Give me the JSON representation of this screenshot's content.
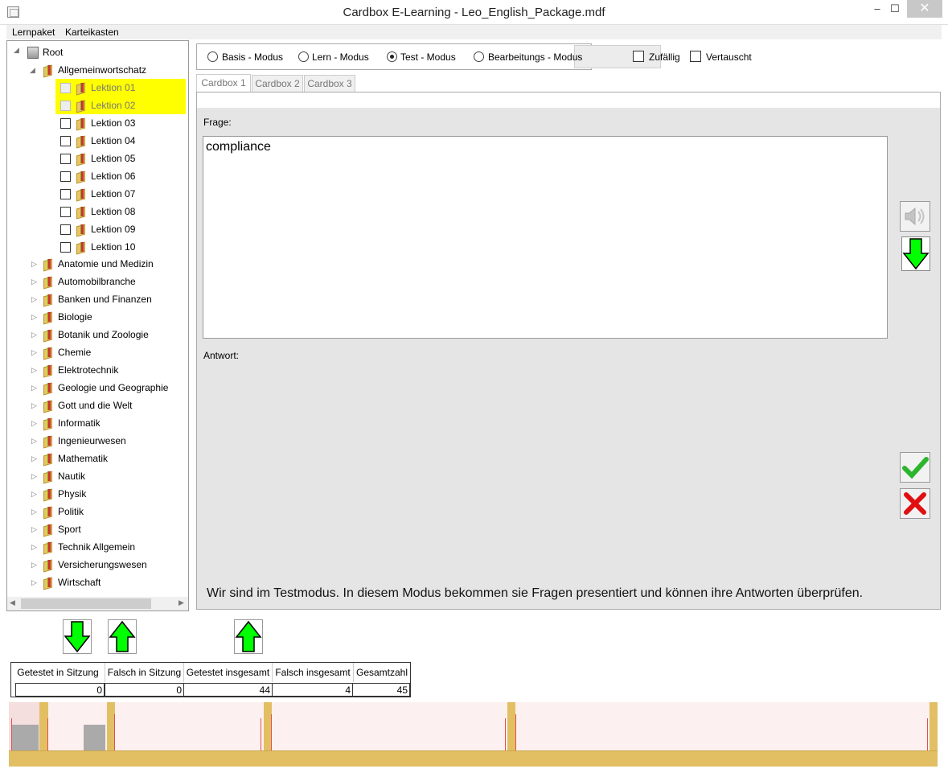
{
  "window": {
    "title": "Cardbox E-Learning - Leo_English_Package.mdf",
    "min": "–",
    "max": "☐",
    "close": "✕"
  },
  "menu": [
    "Lernpaket",
    "Karteikasten"
  ],
  "tree": {
    "root": "Root",
    "expanded": "Allgemeinwortschatz",
    "lessons": [
      "Lektion 01",
      "Lektion 02",
      "Lektion 03",
      "Lektion 04",
      "Lektion 05",
      "Lektion 06",
      "Lektion 07",
      "Lektion 08",
      "Lektion 09",
      "Lektion 10"
    ],
    "highlighted_lessons": [
      "Lektion 01",
      "Lektion 02"
    ],
    "categories": [
      "Anatomie und Medizin",
      "Automobilbranche",
      "Banken und Finanzen",
      "Biologie",
      "Botanik und Zoologie",
      "Chemie",
      "Elektrotechnik",
      "Geologie und Geographie",
      "Gott und die Welt",
      "Informatik",
      "Ingenieurwesen",
      "Mathematik",
      "Nautik",
      "Physik",
      "Politik",
      "Sport",
      "Technik Allgemein",
      "Versicherungswesen",
      "Wirtschaft"
    ]
  },
  "modes": {
    "basis": "Basis - Modus",
    "lern": "Lern - Modus",
    "test": "Test - Modus",
    "bearbeitung": "Bearbeitungs - Modus",
    "selected": "Test - Modus"
  },
  "options": {
    "zufaellig": "Zufällig",
    "vertauscht": "Vertauscht"
  },
  "tabs": [
    "Cardbox 1",
    "Cardbox 2",
    "Cardbox 3"
  ],
  "card": {
    "frage_label": "Frage:",
    "frage": "compliance",
    "antwort_label": "Antwort:",
    "info": "Wir sind im Testmodus. In diesem Modus bekommen sie Fragen presentiert und können ihre Antworten überprüfen."
  },
  "stats": {
    "headers": [
      "Getestet in Sitzung",
      "Falsch in Sitzung",
      "Getestet insgesamt",
      "Falsch insgesamt",
      "Gesamtzahl"
    ],
    "values": [
      "0",
      "0",
      "44",
      "4",
      "45"
    ]
  },
  "colors": {
    "highlight": "#ffff00",
    "accent_green": "#00ff00",
    "strip": "#e2bf63"
  }
}
